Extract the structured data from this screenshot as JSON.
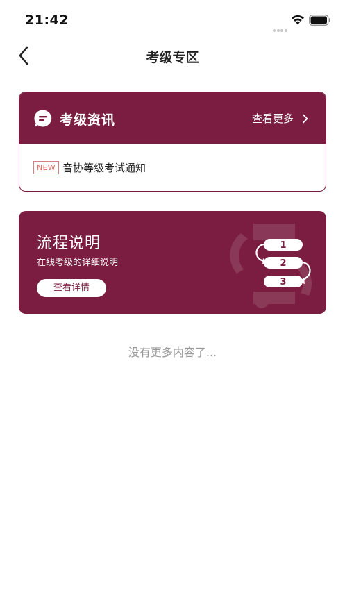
{
  "status_bar": {
    "time": "21:42"
  },
  "nav": {
    "title": "考级专区"
  },
  "news": {
    "title": "考级资讯",
    "more_label": "查看更多",
    "items": [
      {
        "badge": "NEW",
        "text": "音协等级考试通知"
      }
    ]
  },
  "flow": {
    "title": "流程说明",
    "subtitle": "在线考级的详细说明",
    "button_label": "查看详情",
    "steps": [
      "1",
      "2",
      "3"
    ]
  },
  "footer": {
    "no_more_text": "没有更多内容了..."
  },
  "colors": {
    "brand": "#7a1d40",
    "badge": "#e0685f",
    "muted": "#999999"
  },
  "icons": [
    "signal-icon",
    "wifi-icon",
    "battery-icon",
    "back-arrow-icon",
    "chat-bubble-icon",
    "chevron-right-icon",
    "process-steps-icon"
  ]
}
